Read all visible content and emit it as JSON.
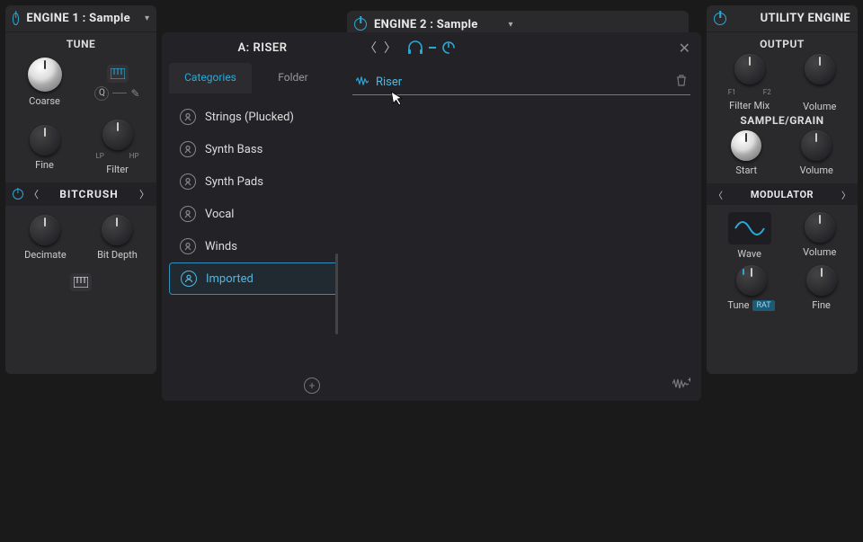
{
  "engine1": {
    "title": "ENGINE 1 :  Sample",
    "tune_label": "TUNE",
    "coarse": "Coarse",
    "fine": "Fine",
    "filter": "Filter",
    "lp": "LP",
    "hp": "HP",
    "q_label": "Q",
    "fx_name": "BITCRUSH",
    "decimate": "Decimate",
    "bitdepth": "Bit Depth"
  },
  "engine2": {
    "title": "ENGINE 2 :  Sample"
  },
  "browser": {
    "title": "A:  RISER",
    "tab_categories": "Categories",
    "tab_folder": "Folder",
    "cats": [
      "Strings (Plucked)",
      "Synth Bass",
      "Synth Pads",
      "Vocal",
      "Winds",
      "Imported"
    ],
    "selected_cat_index": 5,
    "sample_name": "Riser"
  },
  "utility": {
    "title": "UTILITY ENGINE",
    "output_label": "OUTPUT",
    "filter_mix": "Filter Mix",
    "volume": "Volume",
    "f1": "F1",
    "f2": "F2",
    "sample_grain": "SAMPLE/GRAIN",
    "start": "Start",
    "modulator": "MODULATOR",
    "wave": "Wave",
    "tune": "Tune",
    "rat": "RAT",
    "fine": "Fine"
  }
}
